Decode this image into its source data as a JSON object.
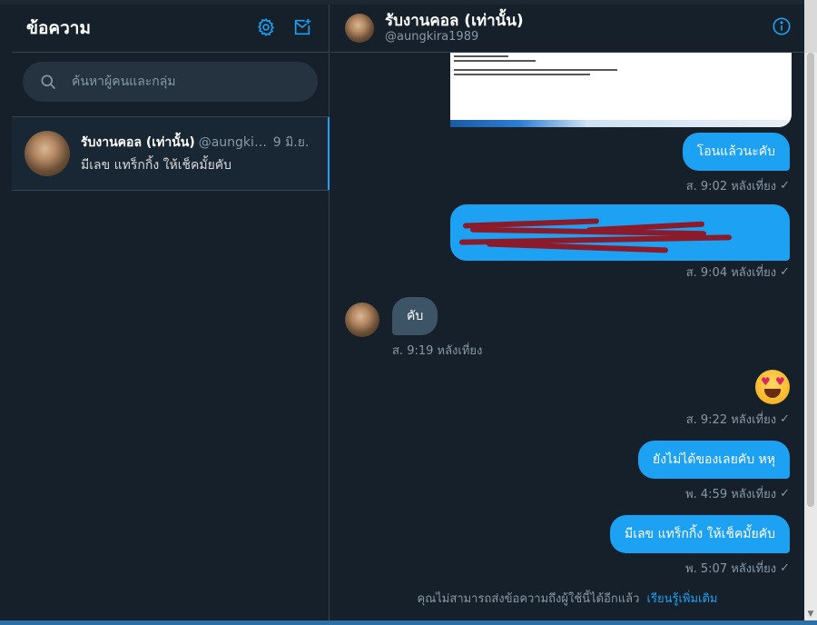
{
  "left": {
    "title": "ข้อความ",
    "search_placeholder": "ค้นหาผู้คนและกลุ่ม",
    "conversation": {
      "name": "รับงานคอล (เท่านั้น)",
      "handle": "@aungkir...",
      "date": "9 มิ.ย.",
      "preview": "มีเลข แทร็กกิ้ง ให้เช็คมั้ยคับ"
    }
  },
  "header": {
    "name": "รับงานคอล (เท่านั้น)",
    "handle": "@aungkira1989"
  },
  "messages": [
    {
      "text": "โอนแล้วนะคับ",
      "time": "ส. 9:02 หลังเที่ยง"
    },
    {
      "text": "",
      "time": "ส. 9:04 หลังเที่ยง"
    },
    {
      "text": "คับ",
      "time": "ส. 9:19 หลังเที่ยง"
    },
    {
      "text": "",
      "time": "ส. 9:22 หลังเที่ยง"
    },
    {
      "text": "ยังไม่ได้ของเลยคับ หหุ",
      "time": "พ. 4:59 หลังเที่ยง"
    },
    {
      "text": "มีเลข แทร็กกิ้ง ให้เช็คมั้ยคับ",
      "time": "พ. 5:07 หลังเที่ยง"
    }
  ],
  "footer": {
    "notice": "คุณไม่สามารถส่งข้อความถึงผู้ใช้นี้ได้อีกแล้ว",
    "link": "เรียนรู้เพิ่มเติม"
  },
  "icons": {
    "settings": "gear-icon",
    "new_message": "new-message-icon",
    "search": "search-icon",
    "info": "info-icon",
    "read_check": "check-icon"
  },
  "colors": {
    "accent": "#1da1f2",
    "background": "#15202b",
    "incoming_bubble": "#3d5466",
    "muted_text": "#8899a6"
  }
}
